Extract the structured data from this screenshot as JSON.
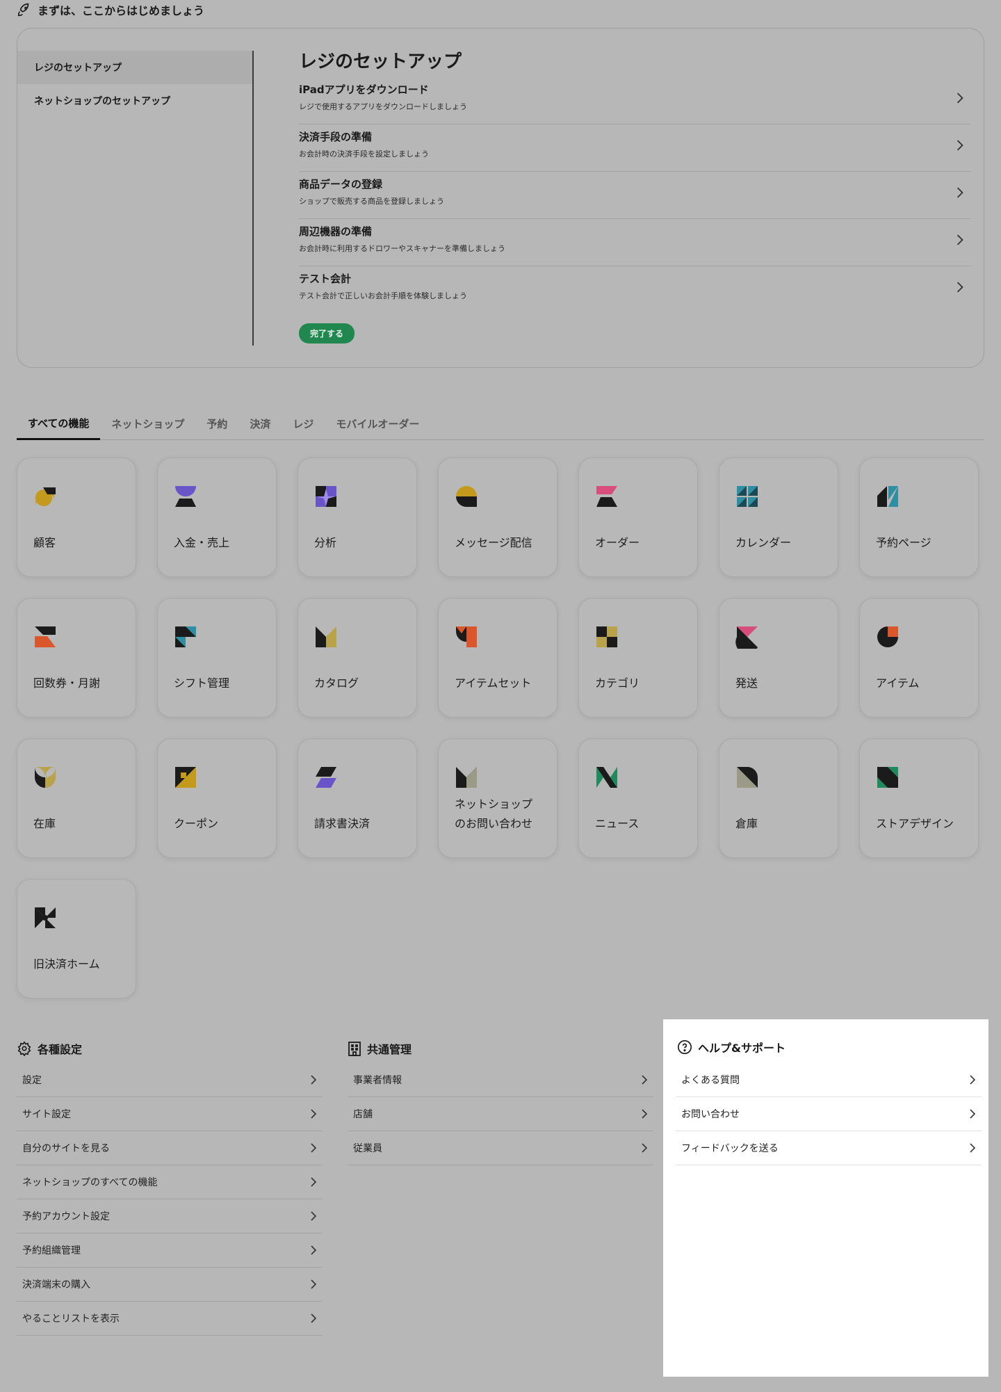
{
  "getting_started": {
    "title": "まずは、ここからはじめましょう"
  },
  "setup": {
    "sidebar": [
      "レジのセットアップ",
      "ネットショップのセットアップ"
    ],
    "heading": "レジのセットアップ",
    "steps": [
      {
        "title": "iPadアプリをダウンロード",
        "desc": "レジで使用するアプリをダウンロードしましょう"
      },
      {
        "title": "決済手段の準備",
        "desc": "お会計時の決済手段を設定しましょう"
      },
      {
        "title": "商品データの登録",
        "desc": "ショップで販売する商品を登録しましょう"
      },
      {
        "title": "周辺機器の準備",
        "desc": "お会計時に利用するドロワーやスキャナーを準備しましょう"
      },
      {
        "title": "テスト会計",
        "desc": "テスト会計で正しいお会計手順を体験しましょう"
      }
    ],
    "complete_button": "完了する"
  },
  "tabs": [
    "すべての機能",
    "ネットショップ",
    "予約",
    "決済",
    "レジ",
    "モバイルオーダー"
  ],
  "features": [
    {
      "label": "顧客",
      "icon": "customer-icon"
    },
    {
      "label": "入金・売上",
      "icon": "deposit-sales-icon"
    },
    {
      "label": "分析",
      "icon": "analytics-icon"
    },
    {
      "label": "メッセージ配信",
      "icon": "message-icon"
    },
    {
      "label": "オーダー",
      "icon": "order-icon"
    },
    {
      "label": "カレンダー",
      "icon": "calendar-icon"
    },
    {
      "label": "予約ページ",
      "icon": "booking-page-icon"
    },
    {
      "label": "回数券・月謝",
      "icon": "ticket-icon"
    },
    {
      "label": "シフト管理",
      "icon": "shift-icon"
    },
    {
      "label": "カタログ",
      "icon": "catalog-icon"
    },
    {
      "label": "アイテムセット",
      "icon": "item-set-icon"
    },
    {
      "label": "カテゴリ",
      "icon": "category-icon"
    },
    {
      "label": "発送",
      "icon": "shipping-icon"
    },
    {
      "label": "アイテム",
      "icon": "item-icon"
    },
    {
      "label": "在庫",
      "icon": "stock-icon"
    },
    {
      "label": "クーポン",
      "icon": "coupon-icon"
    },
    {
      "label": "請求書決済",
      "icon": "invoice-icon"
    },
    {
      "label": "ネットショップ\nのお問い合わせ",
      "icon": "shop-inquiry-icon"
    },
    {
      "label": "ニュース",
      "icon": "news-icon"
    },
    {
      "label": "倉庫",
      "icon": "warehouse-icon"
    },
    {
      "label": "ストアデザイン",
      "icon": "store-design-icon"
    },
    {
      "label": "旧決済ホーム",
      "icon": "old-payment-home-icon"
    }
  ],
  "settings": {
    "title": "各種設定",
    "items": [
      "設定",
      "サイト設定",
      "自分のサイトを見る",
      "ネットショップのすべての機能",
      "予約アカウント設定",
      "予約組織管理",
      "決済端末の購入",
      "やることリストを表示"
    ]
  },
  "shared": {
    "title": "共通管理",
    "items": [
      "事業者情報",
      "店舗",
      "従業員"
    ]
  },
  "help": {
    "title": "ヘルプ&サポート",
    "items": [
      "よくある質問",
      "お問い合わせ",
      "フィードバックを送る"
    ]
  },
  "colors": {
    "accent_green": "#20874f",
    "highlight_panel": "#ffffff",
    "dim_overlay": "#b7b7b7"
  }
}
